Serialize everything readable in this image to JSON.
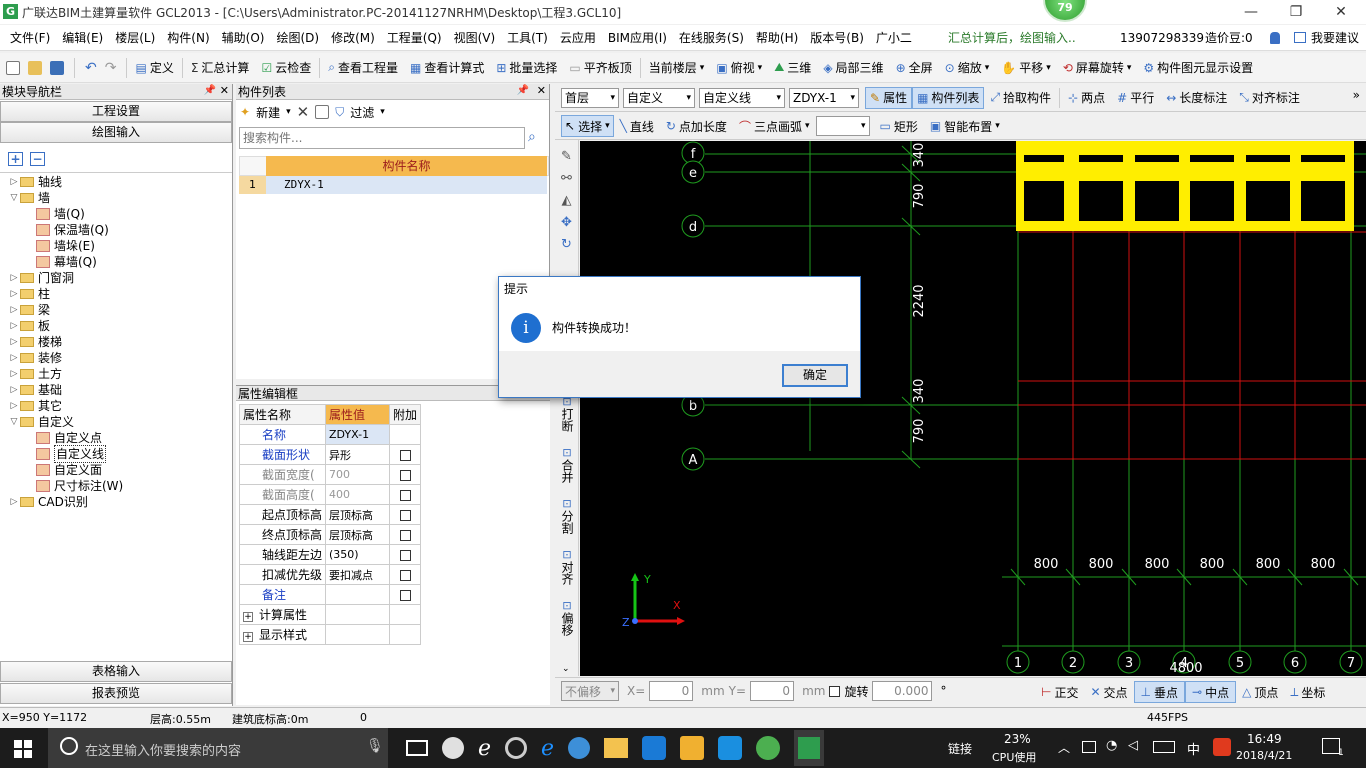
{
  "title": "广联达BIM土建算量软件 GCL2013 - [C:\\Users\\Administrator.PC-20141127NRHM\\Desktop\\工程3.GCL10]",
  "badge": "79",
  "menu": [
    "文件(F)",
    "编辑(E)",
    "楼层(L)",
    "构件(N)",
    "辅助(O)",
    "绘图(D)",
    "修改(M)",
    "工程量(Q)",
    "视图(V)",
    "工具(T)",
    "云应用",
    "BIM应用(I)",
    "在线服务(S)",
    "帮助(H)",
    "版本号(B)",
    "广小二"
  ],
  "menu_right": {
    "notice": "汇总计算后，绘图输入..",
    "phone": "13907298339",
    "beans": "造价豆:0",
    "suggest": "我要建议"
  },
  "toolbar1": [
    "定义",
    "汇总计算",
    "云检查",
    "查看工程量",
    "查看计算式",
    "批量选择",
    "平齐板顶",
    "当前楼层",
    "俯视",
    "三维",
    "局部三维",
    "全屏",
    "缩放",
    "平移",
    "屏幕旋转",
    "构件图元显示设置"
  ],
  "nav": {
    "title": "模块导航栏",
    "btn_project": "工程设置",
    "btn_draw": "绘图输入",
    "btn_table": "表格输入",
    "btn_report": "报表预览",
    "tree": [
      {
        "label": "轴线",
        "level": 0,
        "open": false
      },
      {
        "label": "墙",
        "level": 0,
        "open": true
      },
      {
        "label": "墙(Q)",
        "level": 1
      },
      {
        "label": "保温墙(Q)",
        "level": 1
      },
      {
        "label": "墙垛(E)",
        "level": 1
      },
      {
        "label": "幕墙(Q)",
        "level": 1
      },
      {
        "label": "门窗洞",
        "level": 0,
        "open": false
      },
      {
        "label": "柱",
        "level": 0,
        "open": false
      },
      {
        "label": "梁",
        "level": 0,
        "open": false
      },
      {
        "label": "板",
        "level": 0,
        "open": false
      },
      {
        "label": "楼梯",
        "level": 0,
        "open": false
      },
      {
        "label": "装修",
        "level": 0,
        "open": false
      },
      {
        "label": "土方",
        "level": 0,
        "open": false
      },
      {
        "label": "基础",
        "level": 0,
        "open": false
      },
      {
        "label": "其它",
        "level": 0,
        "open": false
      },
      {
        "label": "自定义",
        "level": 0,
        "open": true
      },
      {
        "label": "自定义点",
        "level": 1
      },
      {
        "label": "自定义线",
        "level": 1,
        "selected": true
      },
      {
        "label": "自定义面",
        "level": 1
      },
      {
        "label": "尺寸标注(W)",
        "level": 1
      },
      {
        "label": "CAD识别",
        "level": 0,
        "open": false
      }
    ]
  },
  "complist": {
    "title": "构件列表",
    "new_btn": "新建",
    "filter_btn": "过滤",
    "search_placeholder": "搜索构件...",
    "col_name": "构件名称",
    "rows": [
      {
        "index": "1",
        "name": "ZDYX-1"
      }
    ]
  },
  "propedit": {
    "title": "属性编辑框",
    "headers": [
      "属性名称",
      "属性值",
      "附加"
    ],
    "rows": [
      {
        "name": "名称",
        "value": "ZDYX-1",
        "check": false,
        "blue": true
      },
      {
        "name": "截面形状",
        "value": "异形",
        "check": true,
        "blue": true
      },
      {
        "name": "截面宽度(",
        "value": "700",
        "check": true,
        "gray": true
      },
      {
        "name": "截面高度(",
        "value": "400",
        "check": true,
        "gray": true
      },
      {
        "name": "起点顶标高",
        "value": "层顶标高",
        "check": true
      },
      {
        "name": "终点顶标高",
        "value": "层顶标高",
        "check": true
      },
      {
        "name": "轴线距左边",
        "value": "(350)",
        "check": true
      },
      {
        "name": "扣减优先级",
        "value": "要扣减点",
        "check": true
      },
      {
        "name": "备注",
        "value": "",
        "check": true,
        "blue": true
      },
      {
        "name": "计算属性",
        "value": "",
        "check": false,
        "expand": true
      },
      {
        "name": "显示样式",
        "value": "",
        "check": false,
        "expand": true
      }
    ]
  },
  "ribbon2": {
    "floor": "首层",
    "type": "自定义",
    "subtype": "自定义线",
    "comp": "ZDYX-1",
    "btn_attr": "属性",
    "btn_list": "构件列表",
    "btn_pick": "拾取构件",
    "btn_twopoint": "两点",
    "btn_parallel": "平行",
    "btn_length": "长度标注",
    "btn_align": "对齐标注"
  },
  "ribbon3": {
    "select": "选择",
    "line": "直线",
    "addlen": "点加长度",
    "arc": "三点画弧",
    "rect": "矩形",
    "smart": "智能布置"
  },
  "lefttools": [
    "打断",
    "合并",
    "分割",
    "对齐",
    "偏移"
  ],
  "canvas": {
    "axis_letters": [
      "f",
      "e",
      "d",
      "b",
      "A"
    ],
    "axis_numbers": [
      "1",
      "2",
      "3",
      "4",
      "5",
      "6",
      "7"
    ],
    "dims_vertical": [
      "340",
      "790",
      "2240",
      "340",
      "790"
    ],
    "dims_horizontal": [
      "800",
      "800",
      "800",
      "800",
      "800",
      "800"
    ],
    "total_dim": "4800",
    "axis_x": "X",
    "axis_y": "Y",
    "axis_z": "Z"
  },
  "statusbar2": {
    "offset": "不偏移",
    "x_label": "X=",
    "x_val": "0",
    "mm1": "mm",
    "y_label": "Y=",
    "y_val": "0",
    "mm2": "mm",
    "rotate": "旋转",
    "rot_val": "0.000",
    "deg": "°",
    "snaps": [
      "正交",
      "交点",
      "垂点",
      "中点",
      "顶点",
      "坐标"
    ]
  },
  "status": {
    "coords": "X=950 Y=1172",
    "floor_h": "层高:0.55m",
    "base_h": "建筑底标高:0m",
    "zero": "0",
    "fps": "445FPS"
  },
  "dialog": {
    "title": "提示",
    "message": "构件转换成功！",
    "ok": "确定"
  },
  "taskbar": {
    "search": "在这里输入你要搜索的内容",
    "link": "链接",
    "cpu_pct": "23%",
    "cpu_label": "CPU使用",
    "ime": "中",
    "time": "16:49",
    "date": "2018/4/21",
    "notif": "1"
  }
}
